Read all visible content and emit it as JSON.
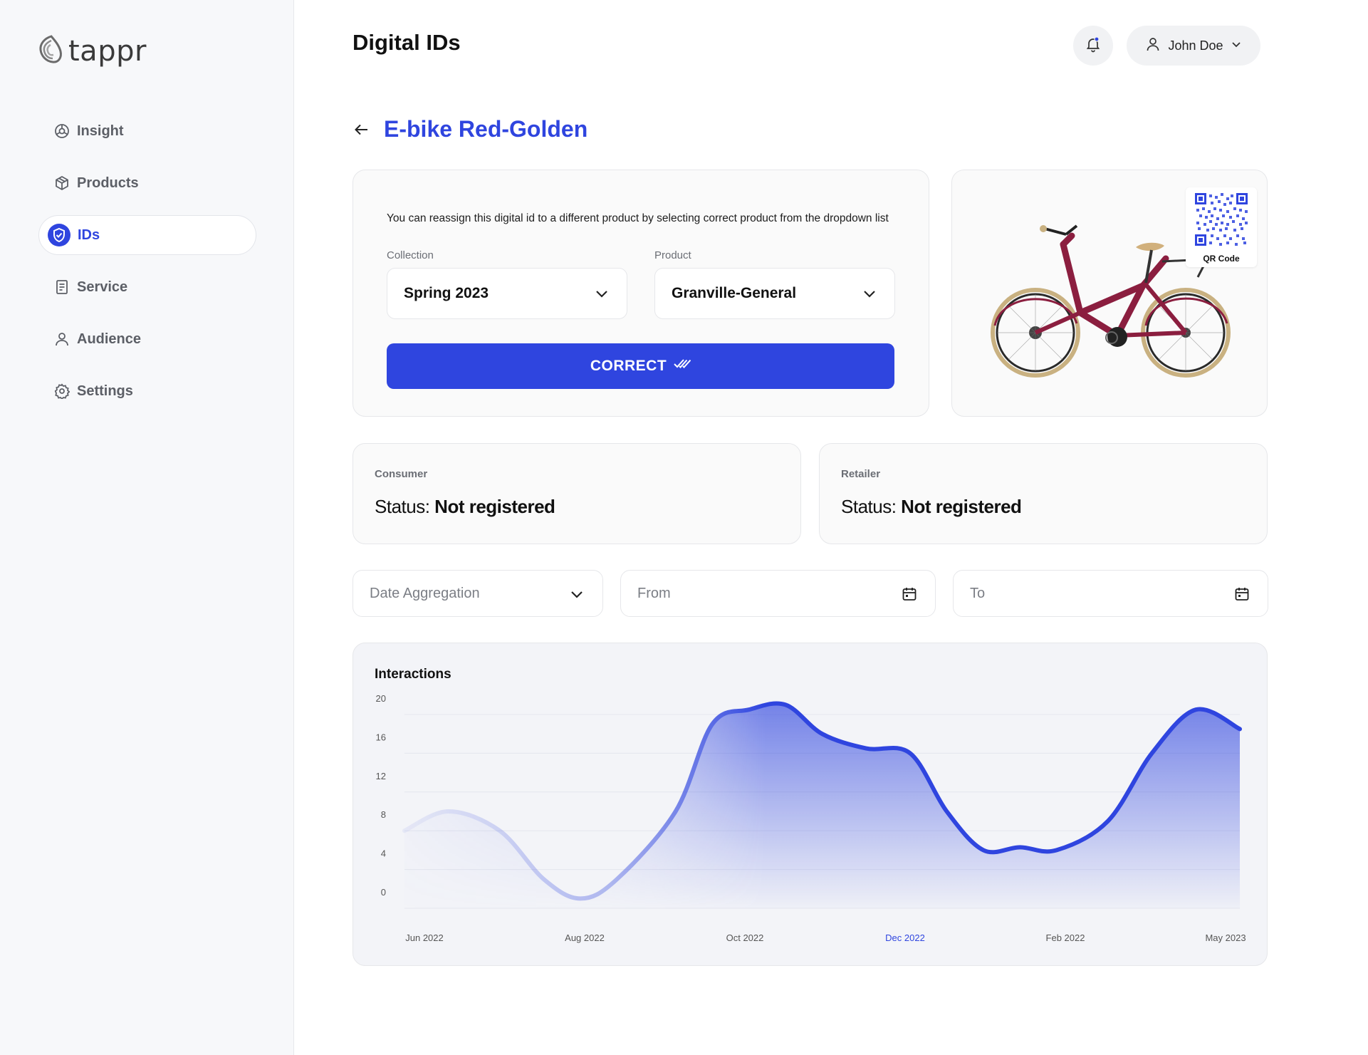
{
  "brand": {
    "name": "tappr"
  },
  "sidebar": {
    "items": [
      {
        "label": "Insight",
        "icon": "insight-icon",
        "active": false
      },
      {
        "label": "Products",
        "icon": "box-icon",
        "active": false
      },
      {
        "label": "IDs",
        "icon": "shield-check-icon",
        "active": true
      },
      {
        "label": "Service",
        "icon": "document-icon",
        "active": false
      },
      {
        "label": "Audience",
        "icon": "user-icon",
        "active": false
      },
      {
        "label": "Settings",
        "icon": "gear-icon",
        "active": false
      }
    ]
  },
  "header": {
    "title": "Digital IDs",
    "user_name": "John Doe"
  },
  "detail": {
    "title": "E-bike Red-Golden",
    "reassign_text": "You can reassign this digital id to a different product by selecting correct product from the dropdown list",
    "collection_label": "Collection",
    "collection_value": "Spring 2023",
    "product_label": "Product",
    "product_value": "Granville-General",
    "correct_label": "CORRECT",
    "qr_label": "QR Code"
  },
  "status": {
    "consumer": {
      "label": "Consumer",
      "prefix": "Status:",
      "value": "Not registered"
    },
    "retailer": {
      "label": "Retailer",
      "prefix": "Status:",
      "value": "Not registered"
    }
  },
  "filters": {
    "date_aggregation": "Date Aggregation",
    "from": "From",
    "to": "To"
  },
  "colors": {
    "accent": "#2f45df",
    "sidebar_bg": "#f7f8fa",
    "bike_frame": "#8b1e3f"
  },
  "chart_data": {
    "type": "area",
    "title": "Interactions",
    "xlabel": "",
    "ylabel": "",
    "y_ticks": [
      "20",
      "16",
      "12",
      "8",
      "4",
      "0"
    ],
    "ylim": [
      0,
      20
    ],
    "x_tick_labels": [
      "Jun 2022",
      "Aug 2022",
      "Oct 2022",
      "Dec 2022",
      "Feb 2022",
      "May 2023"
    ],
    "highlighted_tick": "Dec 2022",
    "series": [
      {
        "x": [
          0,
          0.6,
          1.3,
          1.9,
          2.4,
          2.9,
          3.7,
          4.2,
          4.7,
          5.2,
          5.7,
          6.3,
          6.9,
          7.4,
          7.9,
          8.4,
          8.9,
          9.6,
          10.2,
          10.8,
          11.4
        ],
        "values": [
          8,
          10,
          8,
          3,
          1,
          3,
          10,
          19,
          20.5,
          21,
          18,
          16.5,
          16,
          10,
          6,
          6.3,
          6,
          9,
          16,
          20.5,
          18.5
        ]
      }
    ],
    "grid": true,
    "legend": "none"
  }
}
